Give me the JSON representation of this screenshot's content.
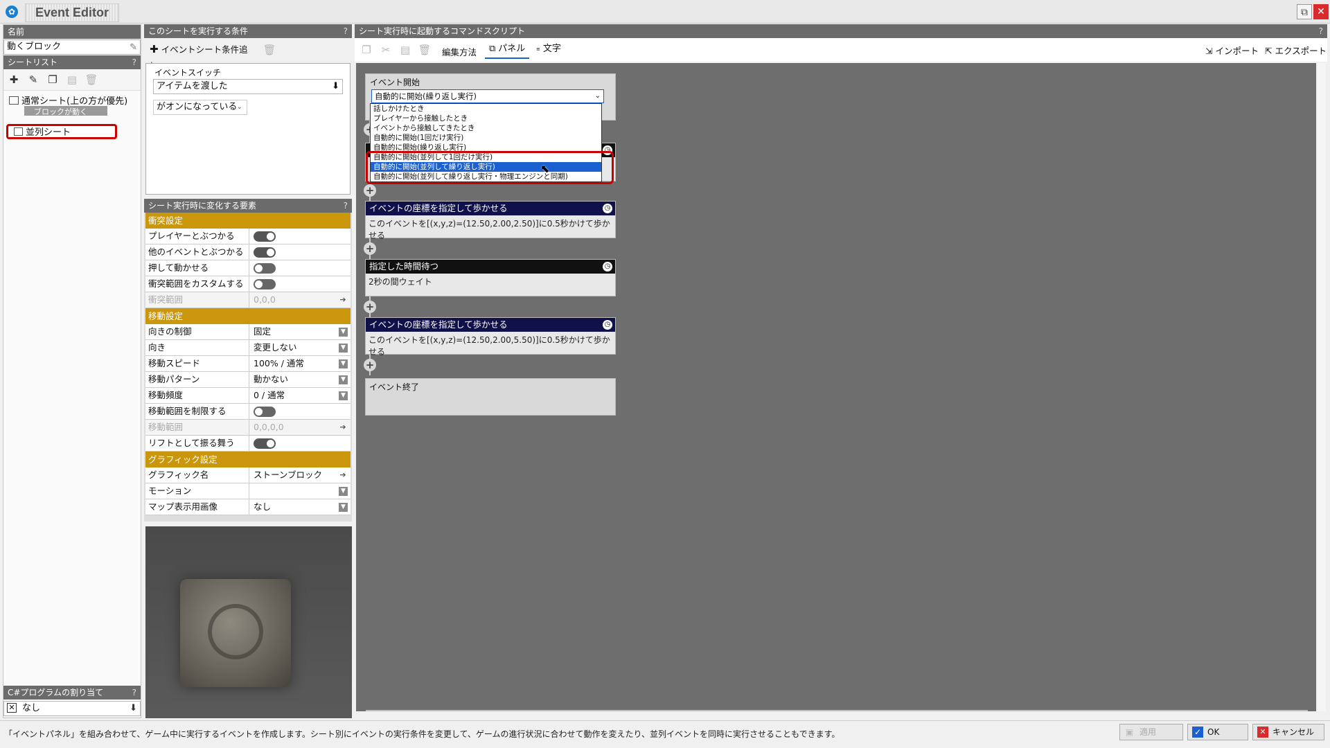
{
  "window": {
    "title": "Event Editor",
    "restore_glyph": "⧉",
    "close_glyph": "✕"
  },
  "left": {
    "name_header": "名前",
    "name_value": "動くブロック",
    "sheetlist_header": "シートリスト",
    "help": "?",
    "sheets": [
      {
        "label": "通常シート(上の方が優先)"
      },
      {
        "label": "ブロックが動く"
      },
      {
        "label": "並列シート"
      }
    ],
    "csharp_header": "C#プログラムの割り当て",
    "csharp_value": "なし"
  },
  "condition": {
    "header": "このシートを実行する条件",
    "help": "?",
    "add_button": "イベントシート条件追加",
    "switch_label": "イベントスイッチ",
    "switch_value": "アイテムを渡した",
    "state_value": "がオンになっている"
  },
  "props": {
    "header": "シート実行時に変化する要素",
    "help": "?",
    "sections": {
      "collision": "衝突設定",
      "movement": "移動設定",
      "graphic": "グラフィック設定"
    },
    "rows": {
      "player_collide": "プレイヤーとぶつかる",
      "event_collide": "他のイベントとぶつかる",
      "pushable": "押して動かせる",
      "custom_range": "衝突範囲をカスタムする",
      "collide_range": "衝突範囲",
      "collide_range_value": "0,0,0",
      "dir_control": "向きの制御",
      "dir_control_value": "固定",
      "direction": "向き",
      "direction_value": "変更しない",
      "speed": "移動スピード",
      "speed_value": "100% / 通常",
      "pattern": "移動パターン",
      "pattern_value": "動かない",
      "frequency": "移動頻度",
      "frequency_value": "0 / 通常",
      "limit_range": "移動範囲を制限する",
      "move_range": "移動範囲",
      "move_range_value": "0,0,0,0",
      "lift": "リフトとして振る舞う",
      "graphic_name": "グラフィック名",
      "graphic_name_value": "ストーンブロック",
      "motion": "モーション",
      "motion_value": "",
      "map_image": "マップ表示用画像",
      "map_image_value": "なし"
    }
  },
  "script": {
    "header": "シート実行時に起動するコマンドスクリプト",
    "help": "?",
    "edit_mode_label": "編集方法",
    "panel_tab": "パネル",
    "text_tab": "文字",
    "import": "インポート",
    "export": "エクスポート",
    "event_start_label": "イベント開始",
    "event_start_value": "自動的に開始(繰り返し実行)",
    "dropdown_options": [
      "話しかけたとき",
      "プレイヤーから接触したとき",
      "イベントから接触してきたとき",
      "自動的に開始(1回だけ実行)",
      "自動的に開始(繰り返し実行)",
      "自動的に開始(並列して1回だけ実行)",
      "自動的に開始(並列して繰り返し実行)",
      "自動的に開始(並列して繰り返し実行・物理エンジンと同期)"
    ],
    "selected_option_index": 6,
    "panels": [
      {
        "title": "イベントの座標を指定して歩かせる",
        "body": "このイベントを[(x,y,z)=(12.50,2.00,2.50)]に0.5秒かけて歩かせる"
      },
      {
        "title": "指定した時間待つ",
        "body": "2秒の間ウェイト"
      },
      {
        "title": "イベントの座標を指定して歩かせる",
        "body": "このイベントを[(x,y,z)=(12.50,2.00,5.50)]に0.5秒かけて歩かせる"
      }
    ],
    "event_end": "イベント終了"
  },
  "status": {
    "hint": "「イベントパネル」を組み合わせて、ゲーム中に実行するイベントを作成します。シート別にイベントの実行条件を変更して、ゲームの進行状況に合わせて動作を変えたり、並列イベントを同時に実行させることもできます。",
    "apply": "適用",
    "ok": "OK",
    "cancel": "キャンセル"
  },
  "colors": {
    "highlight": "#cc0000",
    "section": "#c9960c",
    "header": "#6b6b6b",
    "selection": "#1a60d0",
    "canvas": "#6e6e6e"
  }
}
